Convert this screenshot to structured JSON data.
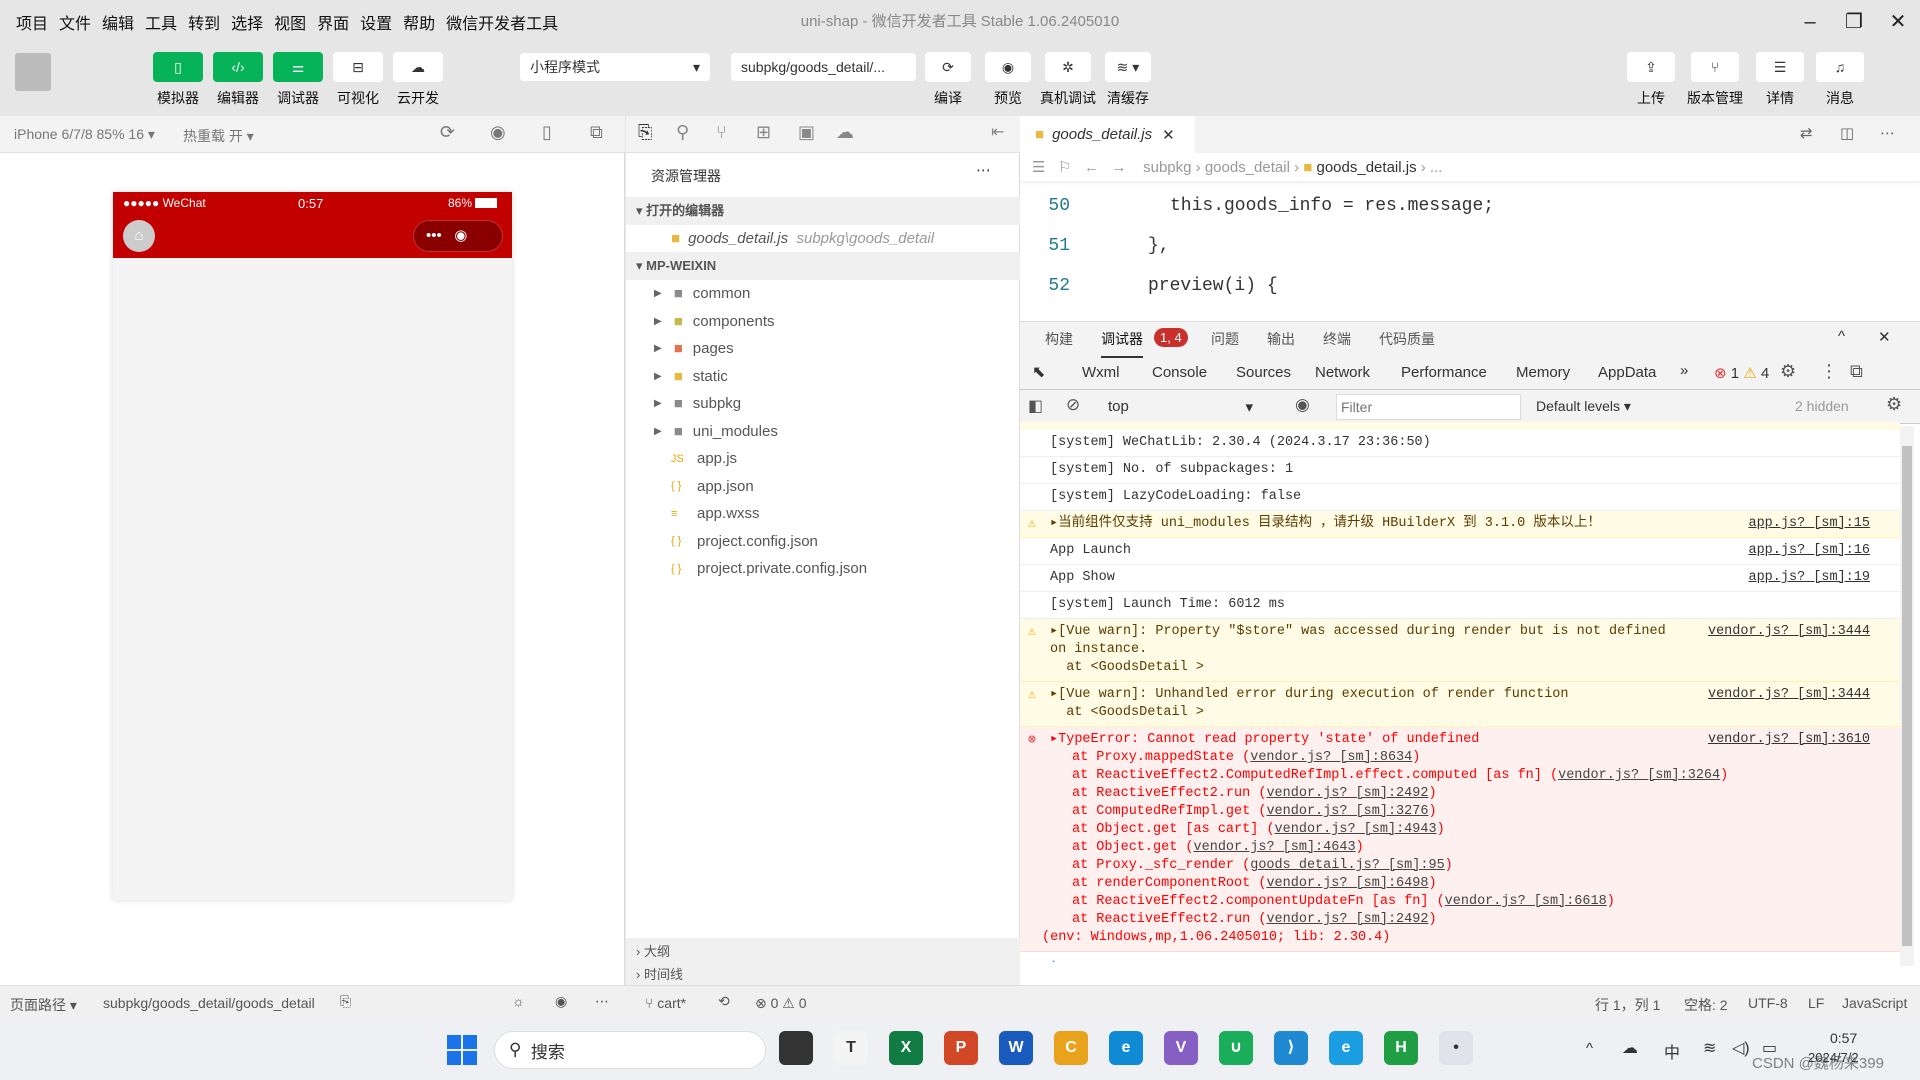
{
  "menu": [
    "项目",
    "文件",
    "编辑",
    "工具",
    "转到",
    "选择",
    "视图",
    "界面",
    "设置",
    "帮助",
    "微信开发者工具"
  ],
  "window_title": "uni-shap - 微信开发者工具 Stable 1.06.2405010",
  "toolbar": {
    "left": [
      {
        "label": "模拟器",
        "icon": "phone-icon",
        "green": true
      },
      {
        "label": "编辑器",
        "icon": "code-icon",
        "green": true
      },
      {
        "label": "调试器",
        "icon": "sliders-icon",
        "green": true
      },
      {
        "label": "可视化",
        "icon": "layout-icon",
        "green": false
      },
      {
        "label": "云开发",
        "icon": "cloud-icon",
        "green": false
      }
    ],
    "mode": "小程序模式",
    "page_path": "subpkg/goods_detail/...",
    "mid": [
      {
        "label": "编译",
        "icon": "refresh-icon"
      },
      {
        "label": "预览",
        "icon": "eye-icon"
      },
      {
        "label": "真机调试",
        "icon": "bug-icon"
      },
      {
        "label": "清缓存",
        "icon": "layers-icon"
      }
    ],
    "right": [
      {
        "label": "上传",
        "icon": "upload-icon"
      },
      {
        "label": "版本管理",
        "icon": "branch-icon"
      },
      {
        "label": "详情",
        "icon": "menu-icon"
      },
      {
        "label": "消息",
        "icon": "bell-icon"
      }
    ]
  },
  "simulator": {
    "device": "iPhone 6/7/8 85% 16 ▾",
    "hot_reload": "热重载 开 ▾",
    "carrier": "●●●●● WeChat",
    "time": "0:57",
    "battery": "86%",
    "header_color": "#c30000"
  },
  "explorer": {
    "title": "资源管理器",
    "open_editors": "打开的编辑器",
    "open_file": "goods_detail.js",
    "open_file_path": "subpkg\\goods_detail",
    "project": "MP-WEIXIN",
    "folders": [
      {
        "name": "common",
        "color": "#8a8a8a"
      },
      {
        "name": "components",
        "color": "#c9b84a"
      },
      {
        "name": "pages",
        "color": "#e2754f"
      },
      {
        "name": "static",
        "color": "#e9b83e"
      },
      {
        "name": "subpkg",
        "color": "#8a8a8a"
      },
      {
        "name": "uni_modules",
        "color": "#8a8a8a"
      }
    ],
    "files": [
      {
        "name": "app.js",
        "icon": "JS"
      },
      {
        "name": "app.json",
        "icon": "{ }"
      },
      {
        "name": "app.wxss",
        "icon": "≡"
      },
      {
        "name": "project.config.json",
        "icon": "{ }"
      },
      {
        "name": "project.private.config.json",
        "icon": "{ }"
      }
    ],
    "outline": "大纲",
    "timeline": "时间线"
  },
  "editor": {
    "tab": "goods_detail.js",
    "breadcrumb": [
      "subpkg",
      "goods_detail",
      "goods_detail.js",
      "..."
    ],
    "lines": [
      {
        "n": "50",
        "code": "this.goods_info = res.message;"
      },
      {
        "n": "51",
        "code": "},"
      },
      {
        "n": "52",
        "code": "preview(i) {"
      }
    ]
  },
  "panel": {
    "tabs": [
      "构建",
      "调试器",
      "问题",
      "输出",
      "终端",
      "代码质量"
    ],
    "badge": "1, 4",
    "devtools_tabs": [
      "Wxml",
      "Console",
      "Sources",
      "Network",
      "Performance",
      "Memory",
      "AppData"
    ],
    "errors": "1",
    "warnings": "4",
    "context": "top",
    "filter_placeholder": "Filter",
    "levels": "Default levels ▾",
    "hidden": "2 hidden"
  },
  "console": [
    {
      "type": "log",
      "text": "[system] WeChatLib: 2.30.4 (2024.3.17 23:36:50)"
    },
    {
      "type": "log",
      "text": "[system] No. of subpackages: 1"
    },
    {
      "type": "log",
      "text": "[system] LazyCodeLoading: false"
    },
    {
      "type": "warn",
      "text": "▸当前组件仅支持 uni_modules 目录结构 ，请升级 HBuilderX 到 3.1.0 版本以上！",
      "src": "app.js? [sm]:15"
    },
    {
      "type": "log",
      "text": "App Launch",
      "src": "app.js? [sm]:16"
    },
    {
      "type": "log",
      "text": "App Show",
      "src": "app.js? [sm]:19"
    },
    {
      "type": "log",
      "text": "[system] Launch Time: 6012 ms"
    },
    {
      "type": "warn",
      "text": "▸[Vue warn]: Property \"$store\" was accessed during render but is not defined\non instance.\n  at <GoodsDetail >",
      "src": "vendor.js? [sm]:3444"
    },
    {
      "type": "warn",
      "text": "▸[Vue warn]: Unhandled error during execution of render function\n  at <GoodsDetail >",
      "src": "vendor.js? [sm]:3444"
    },
    {
      "type": "err",
      "text": "▸TypeError: Cannot read property 'state' of undefined",
      "src": "vendor.js? [sm]:3610",
      "stack": [
        [
          "at Proxy.mappedState",
          "vendor.js? [sm]:8634"
        ],
        [
          "at ReactiveEffect2.ComputedRefImpl.effect.computed [as fn]",
          "vendor.js? [sm]:3264"
        ],
        [
          "at ReactiveEffect2.run",
          "vendor.js? [sm]:2492"
        ],
        [
          "at ComputedRefImpl.get",
          "vendor.js? [sm]:3276"
        ],
        [
          "at Object.get [as cart]",
          "vendor.js? [sm]:4943"
        ],
        [
          "at Object.get",
          "vendor.js? [sm]:4643"
        ],
        [
          "at Proxy._sfc_render",
          "goods_detail.js? [sm]:95"
        ],
        [
          "at renderComponentRoot",
          "vendor.js? [sm]:6498"
        ],
        [
          "at ReactiveEffect2.componentUpdateFn [as fn]",
          "vendor.js? [sm]:6618"
        ],
        [
          "at ReactiveEffect2.run",
          "vendor.js? [sm]:2492"
        ]
      ],
      "env": "(env: Windows,mp,1.06.2405010; lib: 2.30.4)"
    }
  ],
  "status": {
    "page_path_label": "页面路径 ▾",
    "page_path": "subpkg/goods_detail/goods_detail",
    "branch": "cart*",
    "problems": "⊗ 0 ⚠ 0",
    "position": "行 1，列 1",
    "spaces": "空格: 2",
    "encoding": "UTF-8",
    "eol": "LF",
    "language": "JavaScript"
  },
  "taskbar": {
    "search": "搜索",
    "time": "0:57",
    "date": "2024/7/2",
    "ime": "中",
    "apps": [
      {
        "name": "file-icon",
        "c": "#333",
        "t": ""
      },
      {
        "name": "typora-icon",
        "c": "#f4f4f4",
        "t": "T"
      },
      {
        "name": "excel-icon",
        "c": "#107c41",
        "t": "X"
      },
      {
        "name": "powerpoint-icon",
        "c": "#d24726",
        "t": "P"
      },
      {
        "name": "word-icon",
        "c": "#185abd",
        "t": "W"
      },
      {
        "name": "chrome-icon",
        "c": "#e8a21c",
        "t": "C"
      },
      {
        "name": "edge-icon",
        "c": "#0f8bd6",
        "t": "e"
      },
      {
        "name": "visual-studio-icon",
        "c": "#865fc5",
        "t": "V"
      },
      {
        "name": "wechat-devtools-icon",
        "c": "#1aad5a",
        "t": "∪"
      },
      {
        "name": "vscode-icon",
        "c": "#1f8ad2",
        "t": "⟩"
      },
      {
        "name": "edge-dev-icon",
        "c": "#1b9de2",
        "t": "e"
      },
      {
        "name": "hbuilderx-icon",
        "c": "#1f9e44",
        "t": "H"
      },
      {
        "name": "wechat-dev-active-icon",
        "c": "#e0e4ea",
        "t": "•"
      }
    ]
  },
  "watermark": "CSDN @魏杨来399"
}
